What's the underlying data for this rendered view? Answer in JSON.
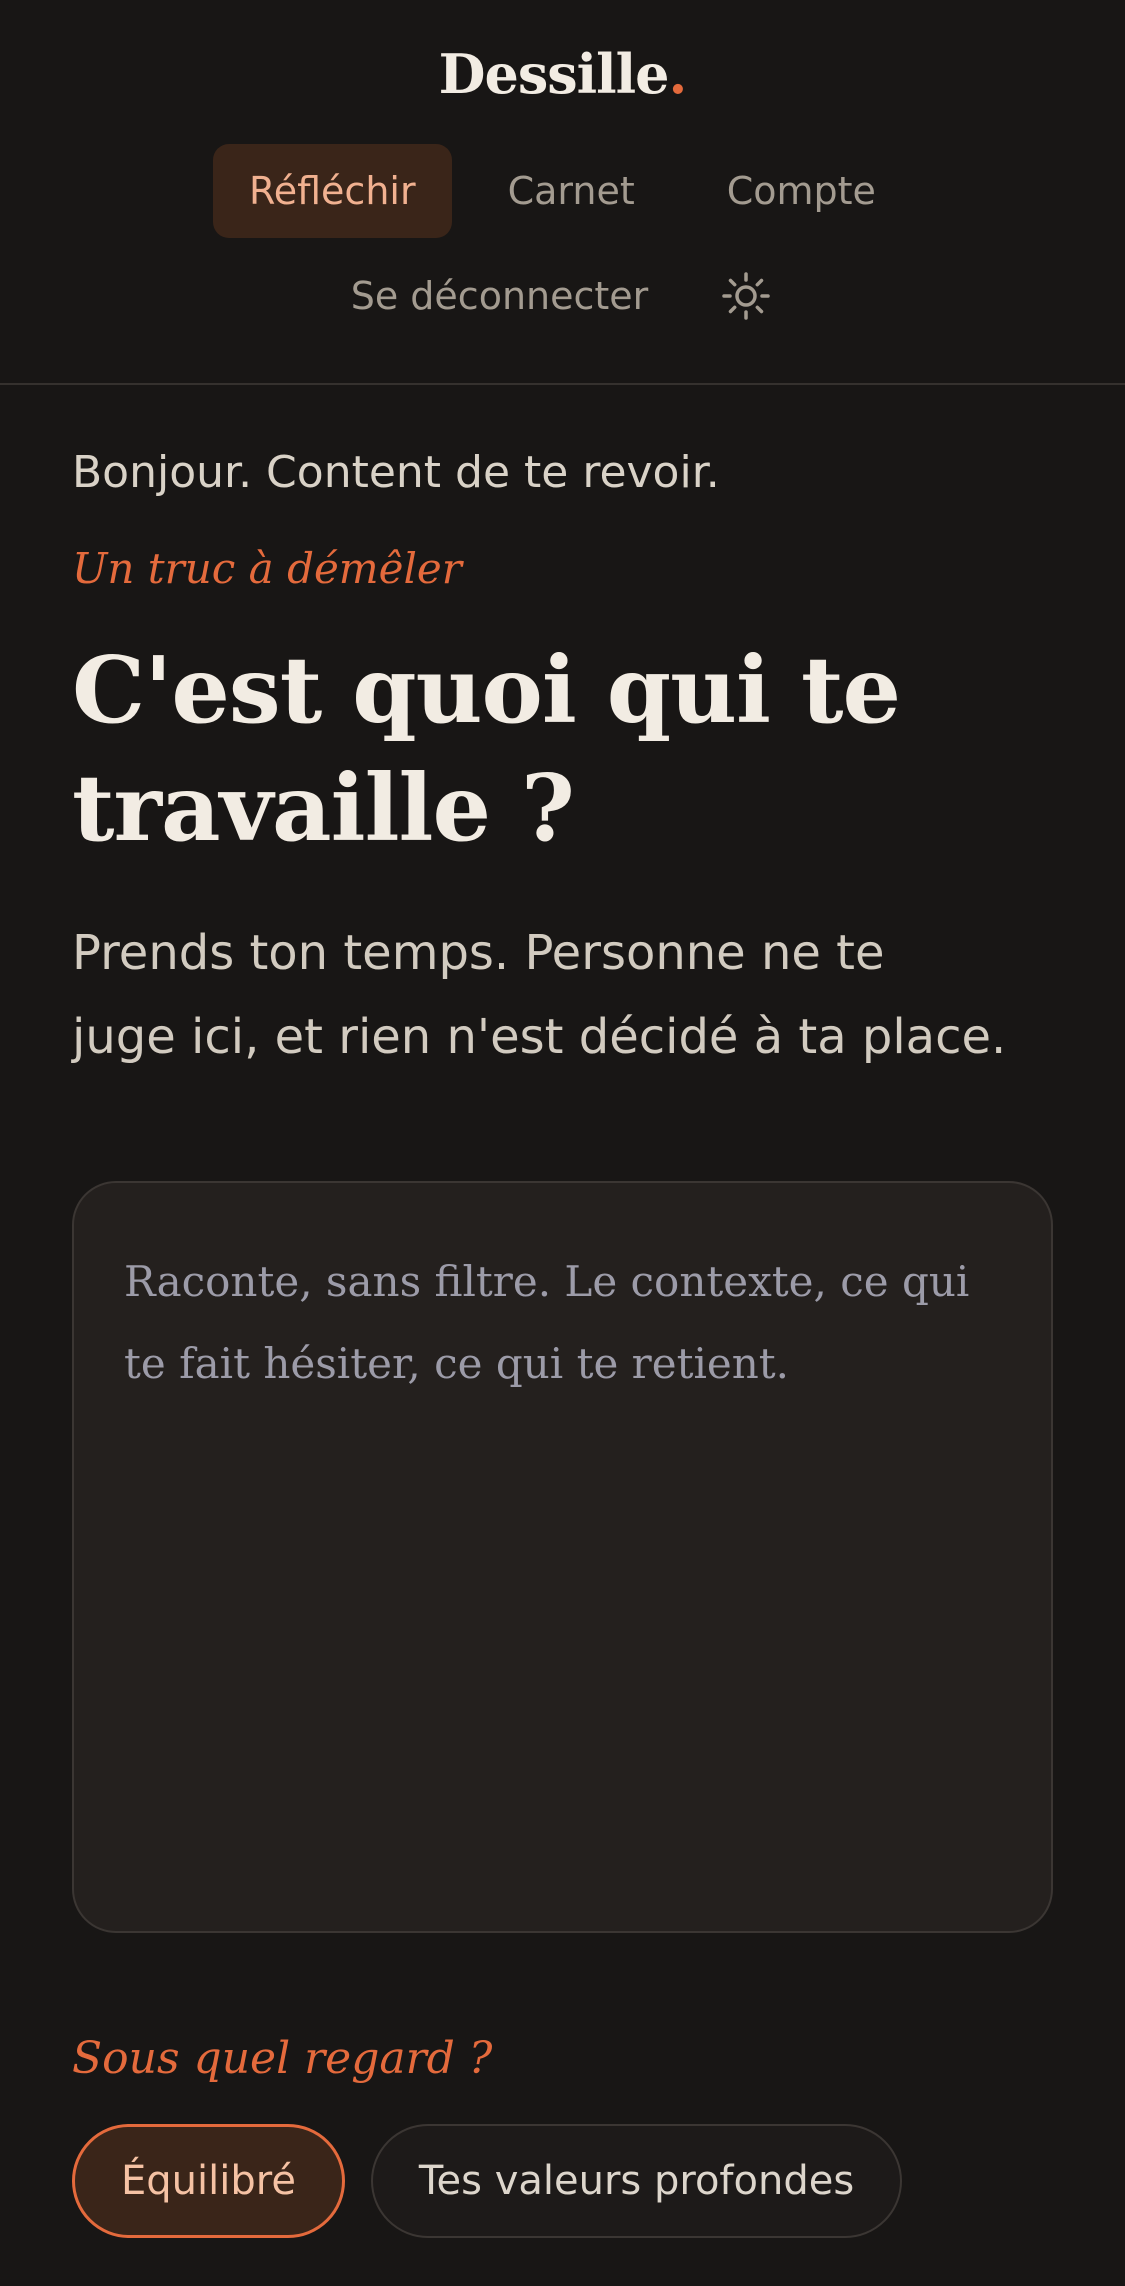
{
  "app": {
    "brand": "Dessille",
    "brand_dot": "."
  },
  "nav": {
    "tabs": [
      {
        "label": "Réfléchir",
        "active": true
      },
      {
        "label": "Carnet",
        "active": false
      },
      {
        "label": "Compte",
        "active": false
      }
    ],
    "logout_label": "Se déconnecter",
    "theme_icon": "sun-icon"
  },
  "main": {
    "greeting": "Bonjour. Content de te revoir.",
    "eyebrow": "Un truc à démêler",
    "title_line1": "C'est quoi qui te",
    "title_line2": "travaille ?",
    "subtitle_line1": "Prends ton temps. Personne ne te",
    "subtitle_line2": "juge ici, et rien n'est décidé à ta place.",
    "textarea": {
      "value": "",
      "placeholder": "Raconte, sans filtre. Le contexte, ce qui te fait hésiter, ce qui te retient."
    },
    "lens_label": "Sous quel regard ?",
    "lens_options": [
      {
        "label": "Équilibré",
        "selected": true
      },
      {
        "label": "Tes valeurs profondes",
        "selected": false
      }
    ]
  },
  "colors": {
    "background": "#181615",
    "accent": "#e46a3c",
    "active_tab_bg": "#3a2519"
  }
}
